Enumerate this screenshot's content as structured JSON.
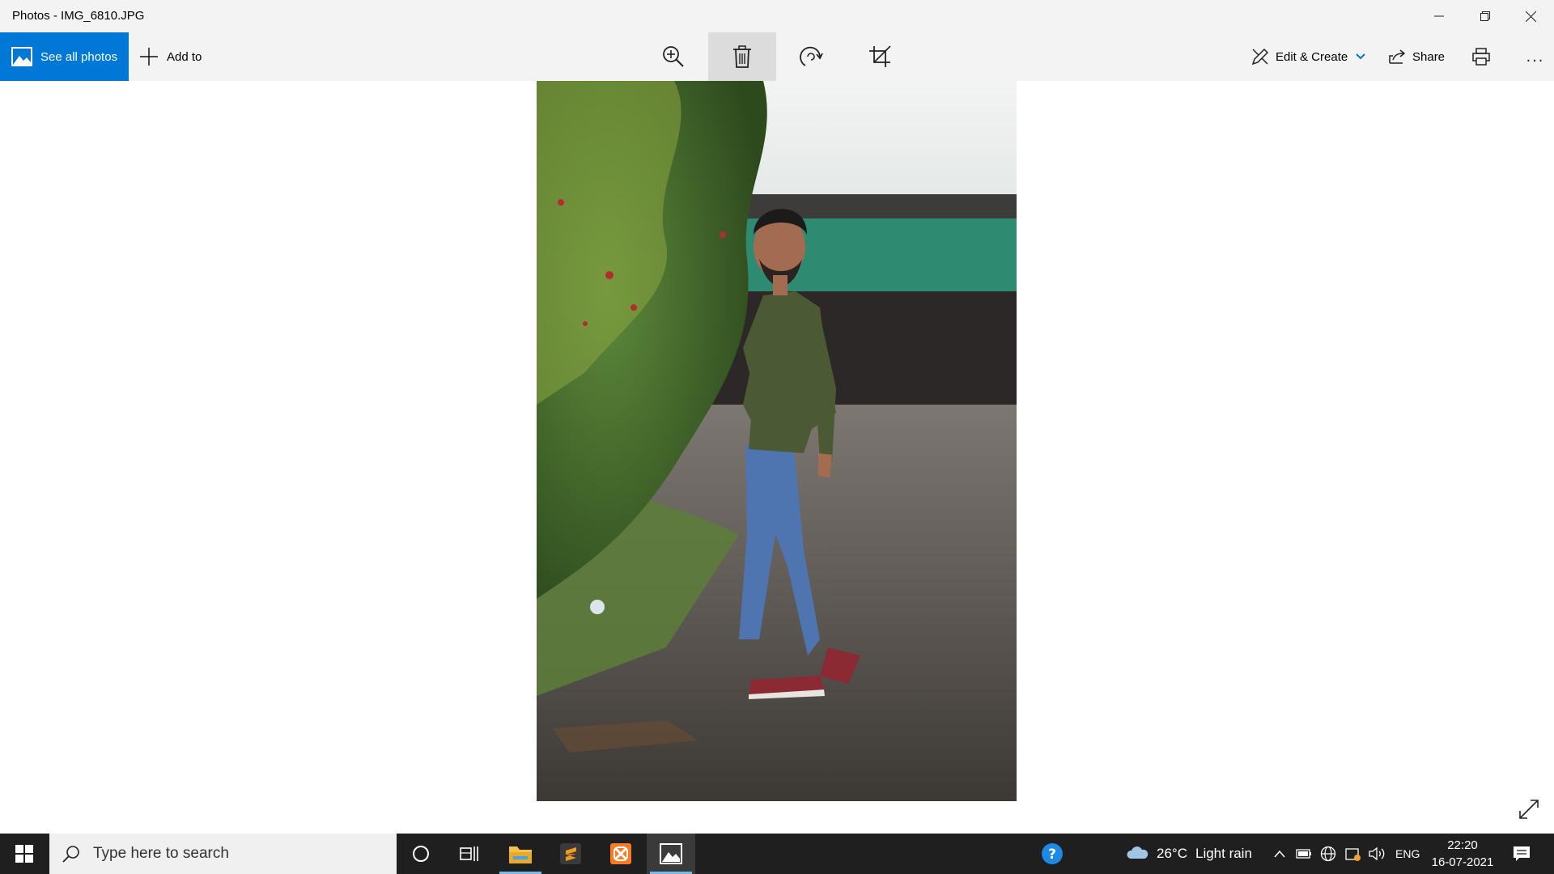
{
  "window": {
    "title": "Photos - IMG_6810.JPG"
  },
  "toolbar": {
    "see_all_label": "See all photos",
    "add_to_label": "Add to",
    "edit_create_label": "Edit & Create",
    "share_label": "Share",
    "more_label": "..."
  },
  "taskbar": {
    "search_placeholder": "Type here to search",
    "weather_temp": "26°C",
    "weather_text": "Light rain",
    "language": "ENG",
    "time": "22:20",
    "date": "16-07-2021"
  },
  "colors": {
    "accent": "#0078d7",
    "titlebar_bg": "#f3f3f3",
    "taskbar_bg": "#1f1f1f",
    "active_tool_bg": "#dcdcdc"
  },
  "icons": {
    "see_all": "photos-landscape-icon",
    "add_to": "plus-icon",
    "zoom": "zoom-in-icon",
    "delete": "trash-icon",
    "rotate": "rotate-icon",
    "crop": "crop-icon",
    "edit": "edit-create-icon",
    "share": "share-icon",
    "print": "print-icon",
    "expand": "fullscreen-icon"
  }
}
